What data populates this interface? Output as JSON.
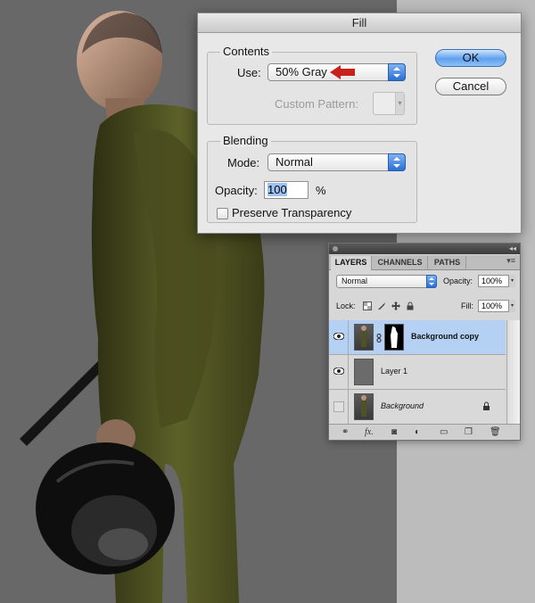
{
  "dialog": {
    "title": "Fill",
    "contents_label": "Contents",
    "use_label": "Use:",
    "use_value": "50% Gray",
    "custom_pattern_label": "Custom Pattern:",
    "blending_label": "Blending",
    "mode_label": "Mode:",
    "mode_value": "Normal",
    "opacity_label": "Opacity:",
    "opacity_value": "100",
    "opacity_unit": "%",
    "preserve_label": "Preserve Transparency",
    "preserve_checked": false,
    "ok_label": "OK",
    "cancel_label": "Cancel"
  },
  "layers_panel": {
    "tabs": [
      "LAYERS",
      "CHANNELS",
      "PATHS"
    ],
    "blend_mode": "Normal",
    "opacity_label": "Opacity:",
    "opacity_value": "100%",
    "lock_label": "Lock:",
    "fill_label": "Fill:",
    "fill_value": "100%",
    "layers": [
      {
        "name": "Background copy",
        "visible": true,
        "selected": true,
        "has_mask": true
      },
      {
        "name": "Layer 1",
        "visible": true,
        "selected": false
      },
      {
        "name": "Background",
        "visible": false,
        "selected": false,
        "locked": true
      }
    ],
    "footer_icons": [
      "link-icon",
      "fx-icon",
      "mask-icon",
      "adjustment-icon",
      "group-icon",
      "new-layer-icon",
      "trash-icon"
    ],
    "footer_fx": "fx."
  },
  "colors": {
    "background_gray": "#686868",
    "right_gray": "#bcbcbc",
    "jacket_olive": "#4f5226",
    "selection_blue": "#b4d0f3",
    "red_arrow": "#c8201a"
  }
}
